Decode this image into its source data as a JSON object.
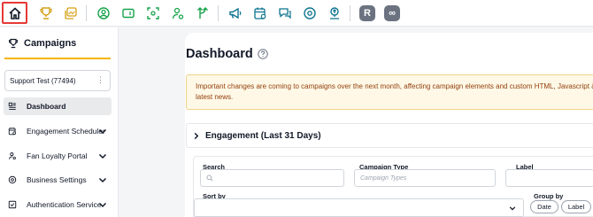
{
  "colors": {
    "accent": "#f5b400",
    "highlight_box": "#e53935",
    "notice_bg": "#fff8e6",
    "notice_text": "#92400e"
  },
  "toolbar": {
    "icons": [
      "home-icon",
      "trophy-icon",
      "gallery-icon",
      "user-circle-icon",
      "card-icon",
      "scan-icon",
      "user-settings-icon",
      "branch-icon",
      "megaphone-icon",
      "calendar-gear-icon",
      "chat-icon",
      "settings-circle-icon",
      "upload-icon",
      "r-app-icon",
      "loop-app-icon"
    ],
    "r_label": "R",
    "loop_label": "∞"
  },
  "sidebar": {
    "title": "Campaigns",
    "account": "Support Test (77494)",
    "account_menu": "⋮",
    "items": [
      {
        "label": "Dashboard"
      },
      {
        "label": "Engagement Scheduler"
      },
      {
        "label": "Fan Loyalty Portal"
      },
      {
        "label": "Business Settings"
      },
      {
        "label": "Authentication Service"
      }
    ]
  },
  "main": {
    "title": "Dashboard",
    "notice_line1": "Important changes are coming to campaigns over the next month, affecting campaign elements and custom HTML, Javascript & C",
    "notice_line2": "latest news.",
    "engagement_header": "Engagement (Last 31 Days)",
    "filters": {
      "search_label": "Search",
      "search_placeholder": "",
      "campaign_type_label": "Campaign Type",
      "campaign_type_placeholder": "Campaign Types",
      "label_label": "Label",
      "sort_by_label": "Sort by",
      "group_by_label": "Group by",
      "group_options": [
        "Date",
        "Label"
      ]
    }
  }
}
